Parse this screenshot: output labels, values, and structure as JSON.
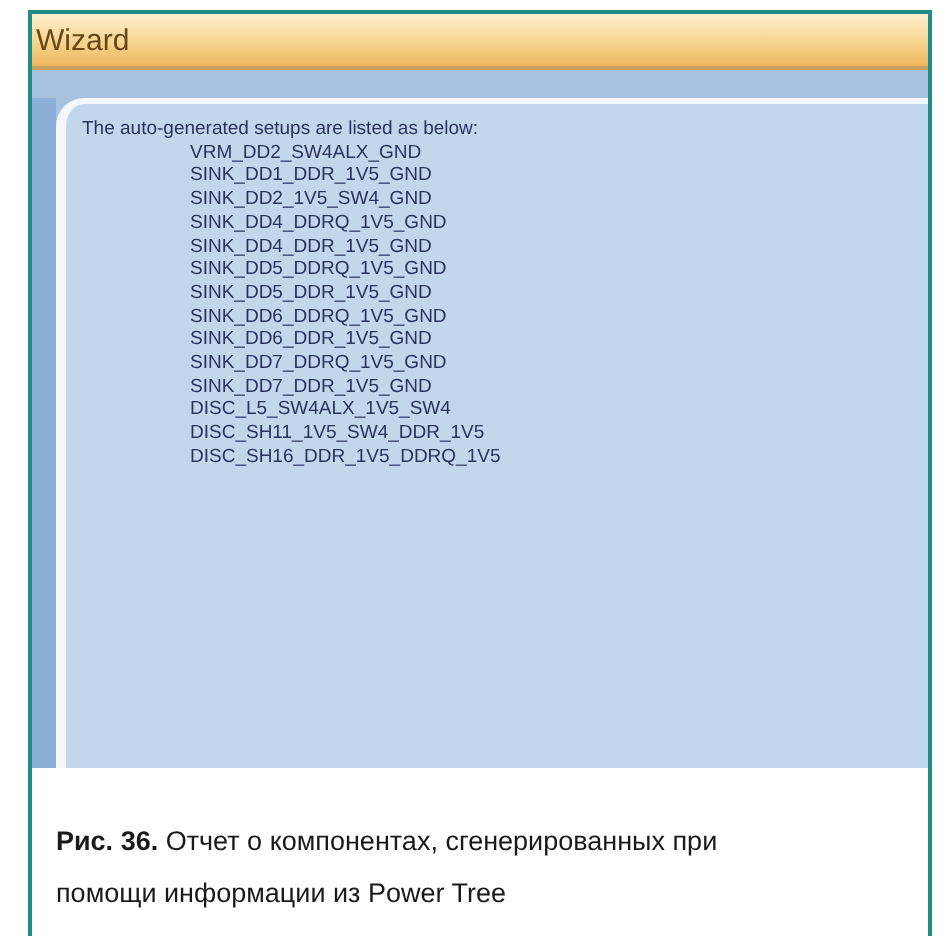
{
  "window": {
    "title": "Wizard"
  },
  "report": {
    "heading": "The auto-generated setups are listed as below:",
    "items": [
      "VRM_DD2_SW4ALX_GND",
      "SINK_DD1_DDR_1V5_GND",
      "SINK_DD2_1V5_SW4_GND",
      "SINK_DD4_DDRQ_1V5_GND",
      "SINK_DD4_DDR_1V5_GND",
      "SINK_DD5_DDRQ_1V5_GND",
      "SINK_DD5_DDR_1V5_GND",
      "SINK_DD6_DDRQ_1V5_GND",
      "SINK_DD6_DDR_1V5_GND",
      "SINK_DD7_DDRQ_1V5_GND",
      "SINK_DD7_DDR_1V5_GND",
      "DISC_L5_SW4ALX_1V5_SW4",
      "DISC_SH11_1V5_SW4_DDR_1V5",
      "DISC_SH16_DDR_1V5_DDRQ_1V5"
    ]
  },
  "caption": "**Рис. 36.** Отчет о компонентах, сгенерированных при помощи информации из Power Tree"
}
